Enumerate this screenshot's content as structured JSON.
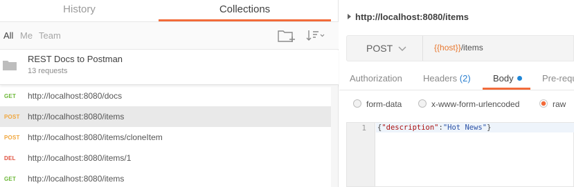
{
  "sidebar": {
    "tabs": [
      "History",
      "Collections"
    ],
    "active_tab": "Collections",
    "filters": [
      "All",
      "Me",
      "Team"
    ],
    "collection": {
      "name": "REST Docs to Postman",
      "count": "13 requests"
    },
    "requests": [
      {
        "method": "GET",
        "url": "http://localhost:8080/docs"
      },
      {
        "method": "POST",
        "url": "http://localhost:8080/items",
        "selected": true
      },
      {
        "method": "POST",
        "url": "http://localhost:8080/items/cloneItem"
      },
      {
        "method": "DEL",
        "url": "http://localhost:8080/items/1"
      },
      {
        "method": "GET",
        "url": "http://localhost:8080/items"
      }
    ]
  },
  "main": {
    "breadcrumb": "http://localhost:8080/items",
    "method": "POST",
    "url_var": "{{host}}",
    "url_path": "/items",
    "tabs": {
      "authorization": "Authorization",
      "headers": "Headers",
      "headers_count": "(2)",
      "body": "Body",
      "prerequest": "Pre-requ"
    },
    "body_modes": [
      "form-data",
      "x-www-form-urlencoded",
      "raw"
    ],
    "selected_mode": "raw",
    "editor": {
      "line_number": "1",
      "code_open": "{",
      "code_key": "\"description\"",
      "code_colon": ":",
      "code_value": "\"Hot News\"",
      "code_close": "}"
    }
  },
  "colors": {
    "accent": "#f26b3a",
    "get": "#6cb838",
    "post": "#f0a53a",
    "delete": "#e0503e",
    "link": "#2a7fd0"
  }
}
